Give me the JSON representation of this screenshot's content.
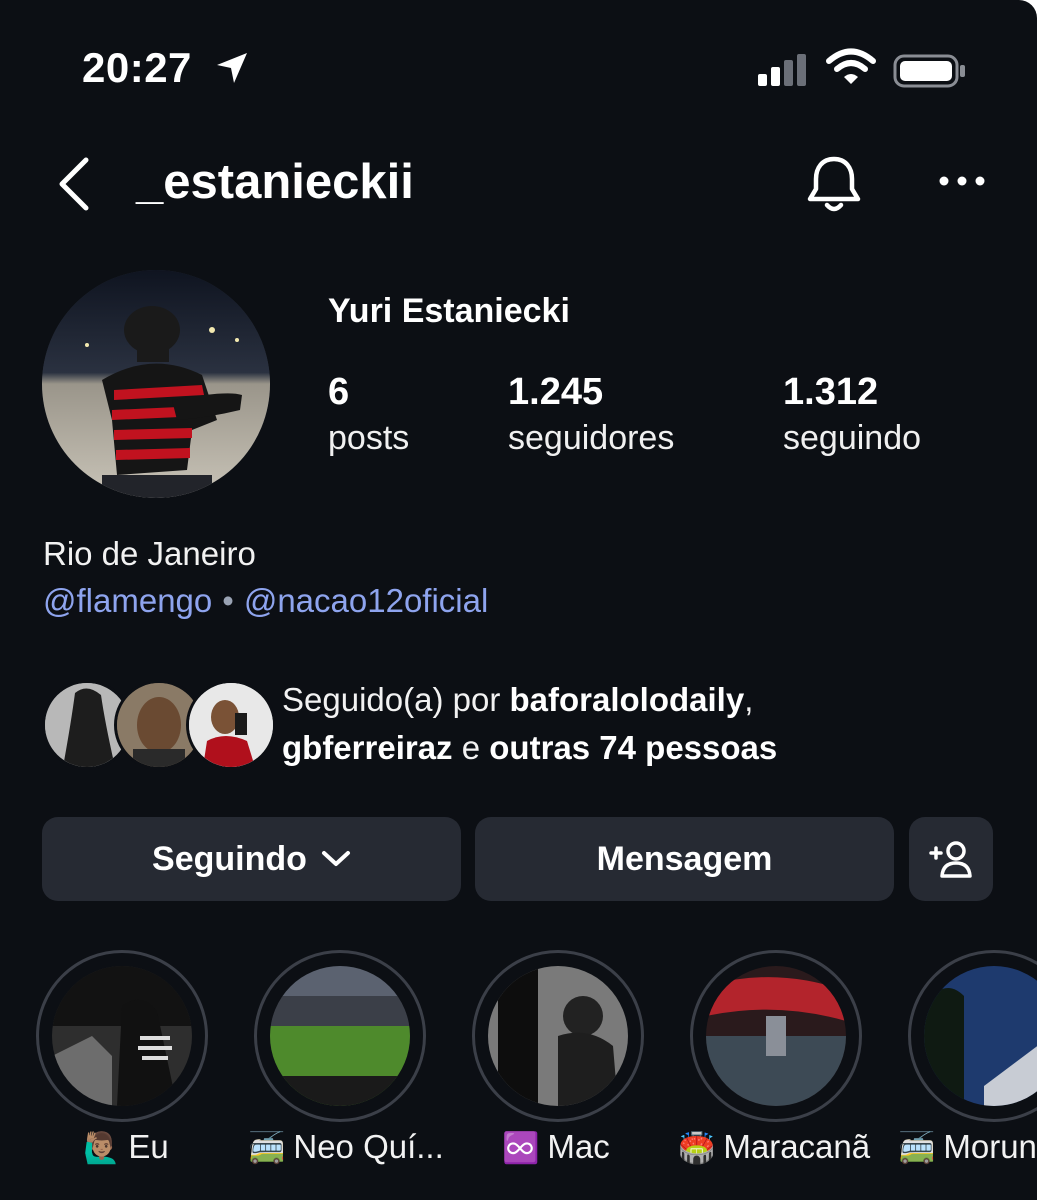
{
  "status_bar": {
    "time": "20:27",
    "location_icon": "location-arrow-icon",
    "signal_icon": "cellular-signal-icon",
    "wifi_icon": "wifi-icon",
    "battery_icon": "battery-icon"
  },
  "header": {
    "username": "_estanieckii",
    "back_icon": "chevron-left-icon",
    "bell_icon": "bell-icon",
    "more_icon": "more-horizontal-icon"
  },
  "profile": {
    "display_name": "Yuri Estaniecki",
    "stats": [
      {
        "value": "6",
        "label": "posts"
      },
      {
        "value": "1.245",
        "label": "seguidores"
      },
      {
        "value": "1.312",
        "label": "seguindo"
      }
    ],
    "bio": {
      "location": "Rio de Janeiro",
      "mention_1": "@flamengo",
      "separator": "•",
      "mention_2": "@nacao12oficial"
    }
  },
  "followed_by": {
    "prefix": "Seguido(a) por ",
    "user_1": "baforalolodaily",
    "comma": ",",
    "user_2": "gbferreiraz",
    "conjunction": " e ",
    "others": "outras 74 pessoas"
  },
  "actions": {
    "following_label": "Seguindo",
    "message_label": "Mensagem",
    "add_user_icon": "add-user-icon"
  },
  "highlights": [
    {
      "emoji": "🙋🏽‍♂️",
      "label": "Eu"
    },
    {
      "emoji": "🚎",
      "label": "Neo Quí..."
    },
    {
      "emoji": "♾️",
      "label": "Mac"
    },
    {
      "emoji": "🏟️",
      "label": "Maracanã"
    },
    {
      "emoji": "🚎",
      "label": "Morun"
    }
  ],
  "colors": {
    "background": "#0c0f14",
    "link": "#8ea4ee",
    "button": "#262a33"
  }
}
